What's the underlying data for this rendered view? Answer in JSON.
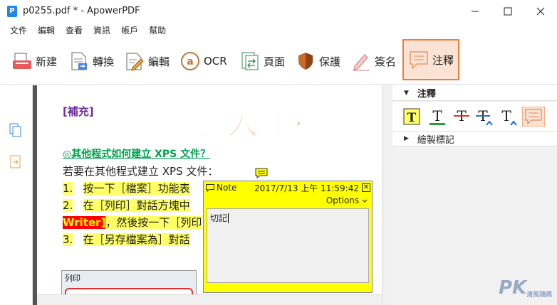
{
  "window": {
    "logo_letter": "P",
    "title": "p0255.pdf * - ApowerPDF"
  },
  "menu": [
    "文件",
    "編輯",
    "查看",
    "資訊",
    "帳戶",
    "幫助"
  ],
  "toolbar": [
    {
      "id": "new",
      "label": "新建",
      "icon": "new-doc-icon"
    },
    {
      "id": "convert",
      "label": "轉換",
      "icon": "convert-icon"
    },
    {
      "id": "edit",
      "label": "編輯",
      "icon": "edit-icon"
    },
    {
      "id": "ocr",
      "label": "OCR",
      "icon": "ocr-icon"
    },
    {
      "id": "page",
      "label": "頁面",
      "icon": "page-icon"
    },
    {
      "id": "protect",
      "label": "保護",
      "icon": "shield-icon"
    },
    {
      "id": "sign",
      "label": "簽名",
      "icon": "pen-icon"
    },
    {
      "id": "annotate",
      "label": "注釋",
      "icon": "comment-icon",
      "active": true
    }
  ],
  "document": {
    "supplement": "[補充]",
    "overlay_title": "加入注釋",
    "subheading": "◎其他程式如何建立 XPS 文件？",
    "line1": "若要在其他程式建立 XPS 文件：",
    "step1_num": "1.",
    "step1": "按一下［檔案］功能表",
    "step2_num": "2.",
    "step2": "在［列印］對話方塊中",
    "step2b_red": "Writer]",
    "step2b": "，然後按一下［列印",
    "step3_num": "3.",
    "step3": "在［另存檔案為］對話",
    "print_dialog_title": "列印"
  },
  "note": {
    "title": "Note",
    "datetime": "2017/7/13 上午 11:59:42",
    "close": "✕",
    "options": "Options",
    "body": "切記"
  },
  "right_panel": {
    "section_annot": "注釋",
    "section_draw": "繪製標記",
    "tools": [
      "highlight-text-icon",
      "underline-text-icon",
      "strikethrough-text-icon",
      "replace-text-icon",
      "insert-text-icon",
      "note-icon"
    ]
  },
  "watermark": {
    "text": "PK",
    "sub": "清風隨跳"
  },
  "colors": {
    "accent": "#f07b3f",
    "note_yellow": "#ffff00",
    "title_orange": "#ff5a1f"
  }
}
